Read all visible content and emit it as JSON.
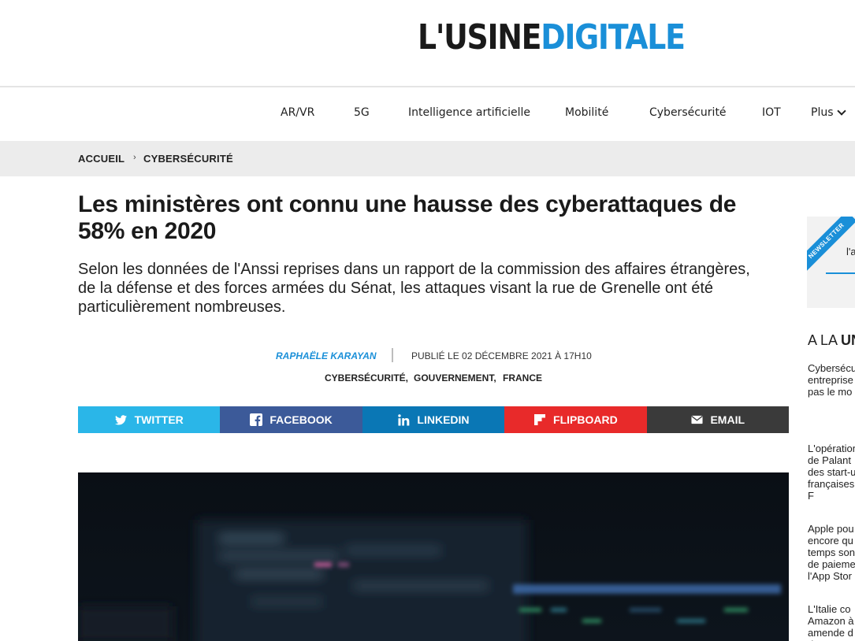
{
  "header": {
    "logo_part1": "L'USINE",
    "logo_part2": "DIGITALE"
  },
  "nav": {
    "items": [
      "AR/VR",
      "5G",
      "Intelligence artificielle",
      "Mobilité",
      "Cybersécurité",
      "IOT"
    ],
    "more_label": "Plus"
  },
  "breadcrumb": {
    "home": "ACCUEIL",
    "separator": "›",
    "section": "CYBERSÉCURITÉ"
  },
  "article": {
    "title": "Les ministères ont connu une hausse des cyberattaques de 58% en 2020",
    "lead": "Selon les données de l'Anssi reprises dans un rapport de la commission des affaires étrangères, de la défense et des forces armées du Sénat, les attaques visant la rue de Grenelle ont été particulièrement nombreuses.",
    "author": "RAPHAËLE KARAYAN",
    "published": "PUBLIÉ LE 02 DÉCEMBRE 2021 À 17H10",
    "tags": [
      "CYBERSÉCURITÉ,",
      "GOUVERNEMENT,",
      "FRANCE"
    ]
  },
  "share": [
    {
      "label": "TWITTER",
      "icon": "twitter-bird-icon",
      "color": "#2ab6e8"
    },
    {
      "label": "FACEBOOK",
      "icon": "facebook-icon",
      "color": "#3c5a99"
    },
    {
      "label": "LINKEDIN",
      "icon": "linkedin-icon",
      "color": "#0a77b5"
    },
    {
      "label": "FLIPBOARD",
      "icon": "flipboard-icon",
      "color": "#e82a2a"
    },
    {
      "label": "EMAIL",
      "icon": "envelope-icon",
      "color": "#3a3a3a"
    }
  ],
  "sidebar": {
    "newsletter_badge": "NEWSLETTER",
    "newsletter_text": "l'a",
    "section_head_prefix": "A LA ",
    "section_head_bold": "UN",
    "items": [
      "Cybersécu\nentreprise\npas le mo",
      "L'opération\nde Palant\ndes start-u\nfrançaises\nF",
      "Apple pou\nencore qu\ntemps son\nde paieme\nl'App Stor",
      "L'Italie co\nAmazon à\namende d\nd'euros p"
    ]
  },
  "colors": {
    "accent": "#1a8fd8",
    "breadcrumb_bg": "#ececec",
    "text": "#1a1a1a"
  }
}
